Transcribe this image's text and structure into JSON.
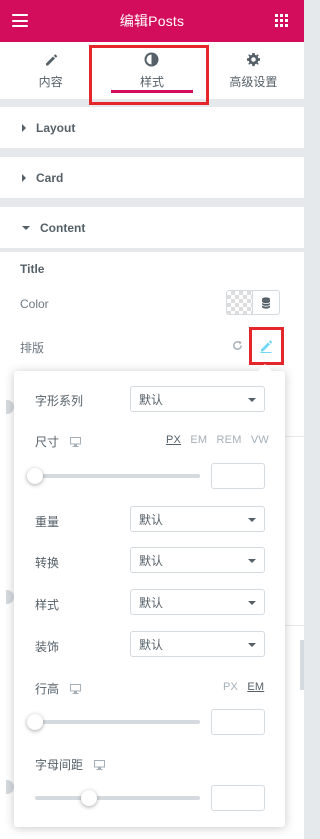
{
  "header": {
    "title": "编辑Posts",
    "menu_icon": "hamburger-icon",
    "apps_icon": "grid-icon"
  },
  "tabs": [
    {
      "label": "内容",
      "icon": "pencil-icon"
    },
    {
      "label": "样式",
      "icon": "half-circle-icon",
      "active": true
    },
    {
      "label": "高级设置",
      "icon": "gear-icon"
    }
  ],
  "sections": [
    {
      "label": "Layout",
      "expanded": false
    },
    {
      "label": "Card",
      "expanded": false
    },
    {
      "label": "Content",
      "expanded": true
    }
  ],
  "content": {
    "group_title": "Title",
    "color_label": "Color",
    "typography_label": "排版"
  },
  "typography": {
    "font_family": {
      "label": "字形系列",
      "value": "默认"
    },
    "size": {
      "label": "尺寸",
      "units": [
        "PX",
        "EM",
        "REM",
        "VW"
      ],
      "active_unit": "PX",
      "value": "",
      "slider_level": 0
    },
    "weight": {
      "label": "重量",
      "value": "默认"
    },
    "transform": {
      "label": "转换",
      "value": "默认"
    },
    "style": {
      "label": "样式",
      "value": "默认"
    },
    "decoration": {
      "label": "装饰",
      "value": "默认"
    },
    "line_height": {
      "label": "行高",
      "units": [
        "PX",
        "EM"
      ],
      "active_unit": "EM",
      "value": "",
      "slider_level": 0
    },
    "letter_spacing": {
      "label": "字母间距",
      "value": "",
      "slider_level": 0.33
    }
  },
  "colors": {
    "brand": "#d30c5c",
    "annotation": "#e5262b",
    "accent": "#71d7f7"
  }
}
